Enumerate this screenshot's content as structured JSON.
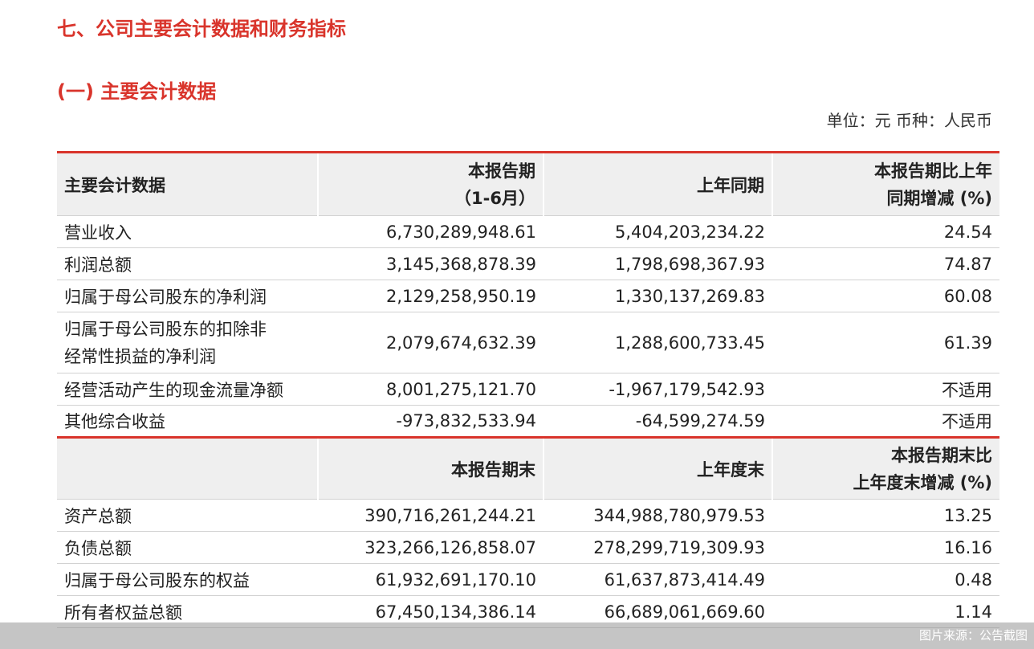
{
  "section_title": "七、公司主要会计数据和财务指标",
  "sub_title": "(一) 主要会计数据",
  "unit": "单位：元 币种：人民币",
  "table1": {
    "headers": {
      "item": "主要会计数据",
      "current_l1": "本报告期",
      "current_l2": "（1-6月）",
      "prior": "上年同期",
      "change_l1": "本报告期比上年",
      "change_l2": "同期增减 (%)"
    },
    "rows": [
      {
        "label": "营业收入",
        "current": "6,730,289,948.61",
        "prior": "5,404,203,234.22",
        "change": "24.54"
      },
      {
        "label": "利润总额",
        "current": "3,145,368,878.39",
        "prior": "1,798,698,367.93",
        "change": "74.87"
      },
      {
        "label": "归属于母公司股东的净利润",
        "current": "2,129,258,950.19",
        "prior": "1,330,137,269.83",
        "change": "60.08"
      },
      {
        "label_l1": "归属于母公司股东的扣除非",
        "label_l2": "经常性损益的净利润",
        "current": "2,079,674,632.39",
        "prior": "1,288,600,733.45",
        "change": "61.39"
      },
      {
        "label": "经营活动产生的现金流量净额",
        "current": "8,001,275,121.70",
        "prior": "-1,967,179,542.93",
        "change": "不适用"
      },
      {
        "label": "其他综合收益",
        "current": "-973,832,533.94",
        "prior": "-64,599,274.59",
        "change": "不适用"
      }
    ]
  },
  "table2": {
    "headers": {
      "item": "",
      "current": "本报告期末",
      "prior": "上年度末",
      "change_l1": "本报告期末比",
      "change_l2": "上年度末增减 (%)"
    },
    "rows": [
      {
        "label": "资产总额",
        "current": "390,716,261,244.21",
        "prior": "344,988,780,979.53",
        "change": "13.25"
      },
      {
        "label": "负债总额",
        "current": "323,266,126,858.07",
        "prior": "278,299,719,309.93",
        "change": "16.16"
      },
      {
        "label": "归属于母公司股东的权益",
        "current": "61,932,691,170.10",
        "prior": "61,637,873,414.49",
        "change": "0.48"
      },
      {
        "label": "所有者权益总额",
        "current": "67,450,134,386.14",
        "prior": "66,689,061,669.60",
        "change": "1.14"
      }
    ]
  },
  "footer": "图片来源：公告截图",
  "colors": {
    "accent": "#d9342b",
    "header_bg": "#efefef"
  }
}
